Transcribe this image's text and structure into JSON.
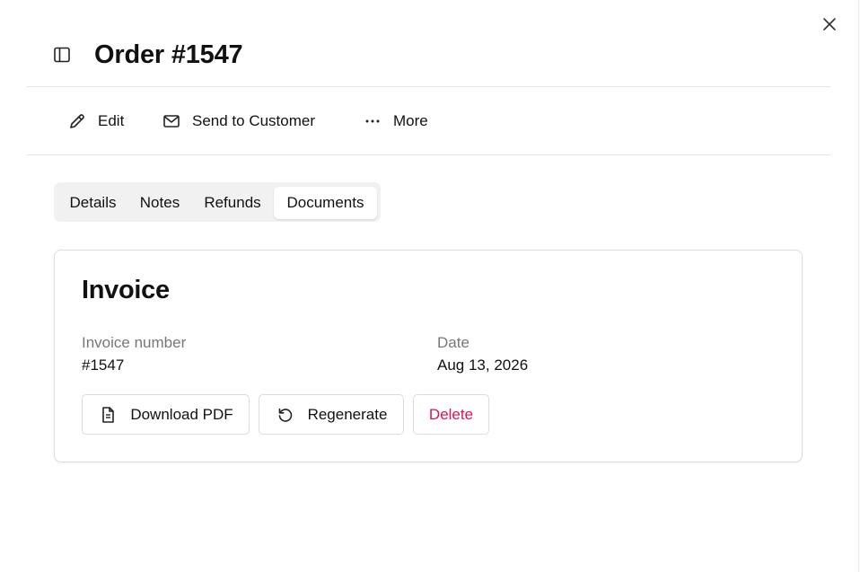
{
  "header": {
    "title": "Order #1547"
  },
  "toolbar": {
    "edit_label": "Edit",
    "send_label": "Send to Customer",
    "more_label": "More"
  },
  "tabs": [
    {
      "label": "Details",
      "active": false
    },
    {
      "label": "Notes",
      "active": false
    },
    {
      "label": "Refunds",
      "active": false
    },
    {
      "label": "Documents",
      "active": true
    }
  ],
  "invoice": {
    "title": "Invoice",
    "number_label": "Invoice number",
    "number_value": "#1547",
    "date_label": "Date",
    "date_value": "Aug 13, 2026",
    "download_label": "Download PDF",
    "regenerate_label": "Regenerate",
    "delete_label": "Delete"
  },
  "icons": {
    "close": "close-icon",
    "sidebar": "sidebar-toggle-icon",
    "edit": "pencil-icon",
    "send": "mail-icon",
    "more": "ellipsis-icon",
    "download": "document-icon",
    "regenerate": "refresh-icon"
  },
  "colors": {
    "danger": "#e0134f",
    "border": "#dcdcdc",
    "tabs_bg": "#f1f1f1"
  }
}
